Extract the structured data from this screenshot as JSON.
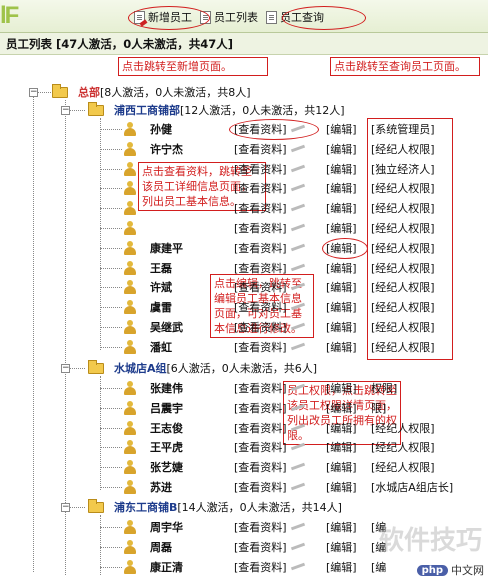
{
  "toolbar": {
    "add": "新增员工",
    "list": "员工列表",
    "query": "员工查询"
  },
  "title": "员工列表 [47人激活，0人未激活，共47人]",
  "callouts": {
    "add": "点击跳转至新增页面。",
    "query": "点击跳转至查询员工页面。",
    "view": "点击查看资料，跳转至该员工详细信息页面，列出员工基本信息。",
    "edit": "点击编辑，跳转至编辑员工基本信息页面，可对员工基本信息进行修改。",
    "perm": "员工权限，点击跳转至该员工权限详情页面，列出改员工所拥有的权限。"
  },
  "tree": {
    "root": {
      "name": "总部",
      "stats": "[8人激活，0人未激活，共8人]"
    },
    "depts": [
      {
        "name": "浦西工商铺部",
        "stats": "[12人激活，0人未激活，共12人]"
      },
      {
        "name": "水城店A组",
        "stats": "[6人激活，0人未激活，共6人]"
      },
      {
        "name": "浦东工商铺B",
        "stats": "[14人激活，0人未激活，共14人]"
      }
    ]
  },
  "actions": {
    "view": "[查看资料]",
    "edit": "[编辑]"
  },
  "employees_a": [
    {
      "name": "孙健",
      "perm": "[系统管理员]"
    },
    {
      "name": "许宁杰",
      "perm": "[经纪人权限]"
    },
    {
      "name": "",
      "perm": "[独立经济人]"
    },
    {
      "name": "",
      "perm": "[经纪人权限]"
    },
    {
      "name": "",
      "perm": "[经纪人权限]"
    },
    {
      "name": "",
      "perm": "[经纪人权限]"
    },
    {
      "name": "康建平",
      "perm": "[经纪人权限]"
    },
    {
      "name": "王磊",
      "perm": "[经纪人权限]"
    },
    {
      "name": "许斌",
      "perm": "[经纪人权限]"
    },
    {
      "name": "虞雷",
      "perm": "[经纪人权限]"
    },
    {
      "name": "吴继武",
      "perm": "[经纪人权限]"
    },
    {
      "name": "潘虹",
      "perm": "[经纪人权限]"
    }
  ],
  "employees_b": [
    {
      "name": "张建伟",
      "perm": "权限]"
    },
    {
      "name": "吕震宇",
      "perm": "限]"
    },
    {
      "name": "王志俊",
      "perm": "[经纪人权限]"
    },
    {
      "name": "王平虎",
      "perm": "[经纪人权限]"
    },
    {
      "name": "张艺婕",
      "perm": "[经纪人权限]"
    },
    {
      "name": "苏进",
      "perm": "[水城店A组店长]"
    }
  ],
  "employees_c": [
    {
      "name": "周宇华",
      "perm": "[编"
    },
    {
      "name": "周磊",
      "perm": "[编"
    },
    {
      "name": "康正清",
      "perm": "[编"
    }
  ],
  "watermark": "软件技巧",
  "badge": {
    "pill": "php",
    "text": "中文网"
  }
}
